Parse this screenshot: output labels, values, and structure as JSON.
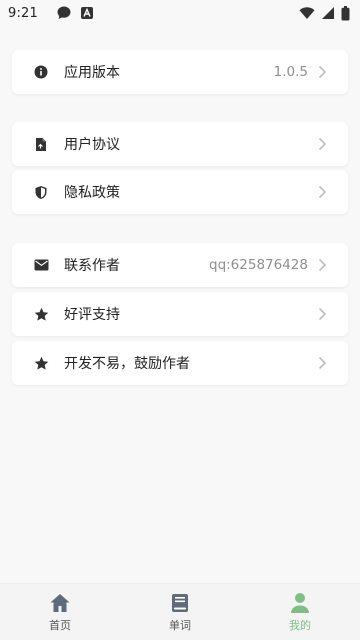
{
  "status_bar": {
    "time": "9:21"
  },
  "groups": [
    {
      "items": [
        {
          "label": "应用版本",
          "value": "1.0.5",
          "icon": "info-icon"
        }
      ]
    },
    {
      "items": [
        {
          "label": "用户协议",
          "value": "",
          "icon": "document-icon"
        },
        {
          "label": "隐私政策",
          "value": "",
          "icon": "shield-icon"
        }
      ]
    },
    {
      "items": [
        {
          "label": "联系作者",
          "value": "qq:625876428",
          "icon": "mail-icon"
        },
        {
          "label": "好评支持",
          "value": "",
          "icon": "star-icon"
        },
        {
          "label": "开发不易，鼓励作者",
          "value": "",
          "icon": "star-icon"
        }
      ]
    }
  ],
  "bottom_nav": {
    "items": [
      {
        "label": "首页",
        "icon": "home-icon",
        "active": false
      },
      {
        "label": "单词",
        "icon": "book-icon",
        "active": false
      },
      {
        "label": "我的",
        "icon": "person-icon",
        "active": true
      }
    ]
  },
  "colors": {
    "background": "#f8f8f8",
    "card": "#ffffff",
    "accent": "#7fbf85",
    "icon": "#333333",
    "muted": "#8f8f8f"
  }
}
